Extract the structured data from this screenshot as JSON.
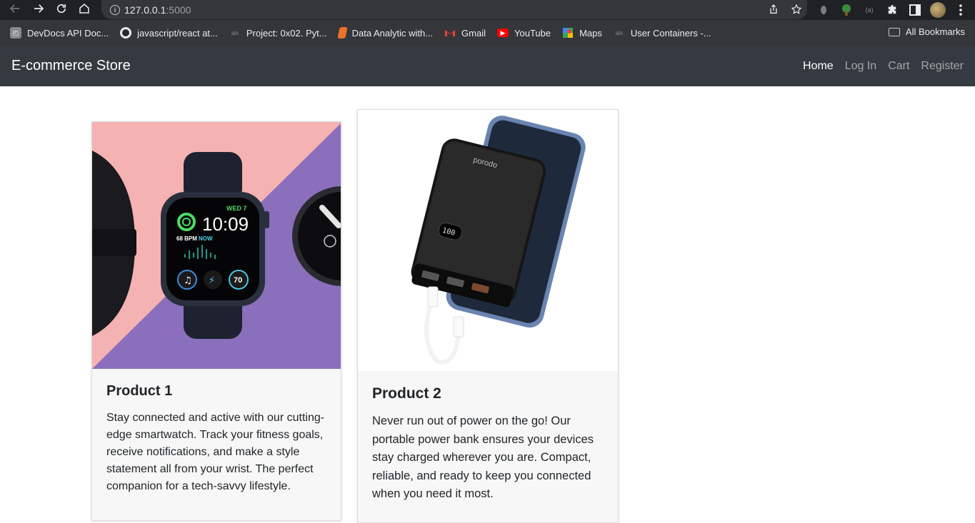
{
  "browser": {
    "url_host": "127.0.0.1",
    "url_port": ":5000",
    "bookmarks": [
      {
        "label": "DevDocs API Doc...",
        "icon": "devdocs-icon",
        "color": "#8a8a8a"
      },
      {
        "label": "javascript/react at...",
        "icon": "github-icon",
        "color": "#24292e"
      },
      {
        "label": "Project: 0x02. Pyt...",
        "icon": "alx-icon",
        "color": "#444444"
      },
      {
        "label": "Data Analytic with...",
        "icon": "book-icon",
        "color": "#e8742b"
      },
      {
        "label": "Gmail",
        "icon": "gmail-icon",
        "color": "#ea4335"
      },
      {
        "label": "YouTube",
        "icon": "youtube-icon",
        "color": "#ff0000"
      },
      {
        "label": "Maps",
        "icon": "maps-icon",
        "color": "#34a853"
      },
      {
        "label": "User Containers -...",
        "icon": "alx-icon",
        "color": "#444444"
      }
    ],
    "all_bookmarks_label": "All Bookmarks"
  },
  "navbar": {
    "brand": "E-commerce Store",
    "links": [
      "Home",
      "Log In",
      "Cart",
      "Register"
    ],
    "active_link": "Home"
  },
  "products": [
    {
      "title": "Product 1",
      "description": "Stay connected and active with our cutting-edge smartwatch. Track your fitness goals, receive notifications, and make a style statement all from your wrist. The perfect companion for a tech-savvy lifestyle.",
      "watch_date": "WED 7",
      "watch_time": "10:09",
      "watch_bpm": "68 BPM",
      "watch_bpm_now": "NOW",
      "watch_ring": "70"
    },
    {
      "title": "Product 2",
      "description": "Never run out of power on the go! Our portable power bank ensures your devices stay charged wherever you are. Compact, reliable, and ready to keep you connected when you need it most.",
      "bank_brand": "porodo",
      "bank_display": "100"
    }
  ]
}
